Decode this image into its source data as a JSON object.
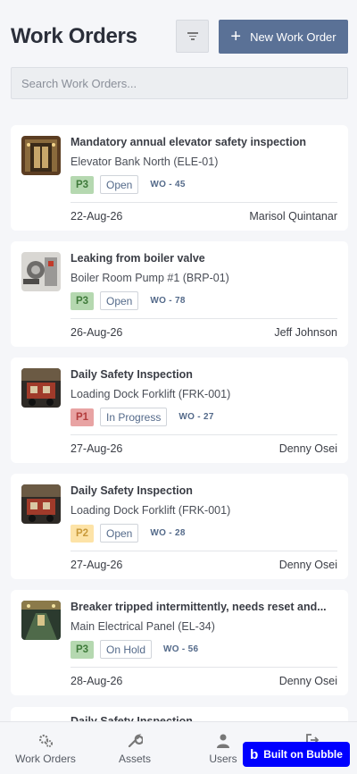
{
  "header": {
    "title": "Work Orders",
    "filter_icon": "filter-icon",
    "new_button_label": "New Work Order",
    "new_button_icon": "plus-icon"
  },
  "search": {
    "placeholder": "Search Work Orders..."
  },
  "work_orders": [
    {
      "title": "Mandatory annual elevator safety inspection",
      "asset": "Elevator Bank North (ELE-01)",
      "priority": "P3",
      "status": "Open",
      "wo_number": "WO - 45",
      "date": "22-Aug-26",
      "assignee": "Marisol Quintanar",
      "thumb": "elevator-photo"
    },
    {
      "title": "Leaking from boiler valve",
      "asset": "Boiler Room Pump #1 (BRP-01)",
      "priority": "P3",
      "status": "Open",
      "wo_number": "WO - 78",
      "date": "26-Aug-26",
      "assignee": "Jeff Johnson",
      "thumb": "boiler-photo"
    },
    {
      "title": "Daily Safety Inspection",
      "asset": "Loading Dock Forklift (FRK-001)",
      "priority": "P1",
      "status": "In Progress",
      "wo_number": "WO - 27",
      "date": "27-Aug-26",
      "assignee": "Denny Osei",
      "thumb": "forklift-photo"
    },
    {
      "title": "Daily Safety Inspection",
      "asset": "Loading Dock Forklift (FRK-001)",
      "priority": "P2",
      "status": "Open",
      "wo_number": "WO - 28",
      "date": "27-Aug-26",
      "assignee": "Denny Osei",
      "thumb": "forklift-photo"
    },
    {
      "title": "Breaker tripped intermittently, needs reset and...",
      "asset": "Main Electrical Panel (EL-34)",
      "priority": "P3",
      "status": "On Hold",
      "wo_number": "WO - 56",
      "date": "28-Aug-26",
      "assignee": "Denny Osei",
      "thumb": "electrical-photo"
    }
  ],
  "partial_card": {
    "title": "Daily Safety Inspection"
  },
  "priority_colors": {
    "P1": {
      "bg": "#e8a3a3",
      "fg": "#b23b3b"
    },
    "P2": {
      "bg": "#fde3a7",
      "fg": "#c99a3a"
    },
    "P3": {
      "bg": "#b5d8b0",
      "fg": "#3f7a3a"
    }
  },
  "bottom_nav": {
    "items": [
      {
        "label": "Work Orders",
        "icon": "gears-icon"
      },
      {
        "label": "Assets",
        "icon": "wrench-icon"
      },
      {
        "label": "Users",
        "icon": "user-icon"
      },
      {
        "label": "",
        "icon": "logout-icon"
      }
    ]
  },
  "badge": {
    "label": "Built on Bubble",
    "icon": "bubble-logo"
  },
  "colors": {
    "accent": "#5a7196",
    "bubble_blue": "#0000ff",
    "background": "#f5f6f9"
  }
}
